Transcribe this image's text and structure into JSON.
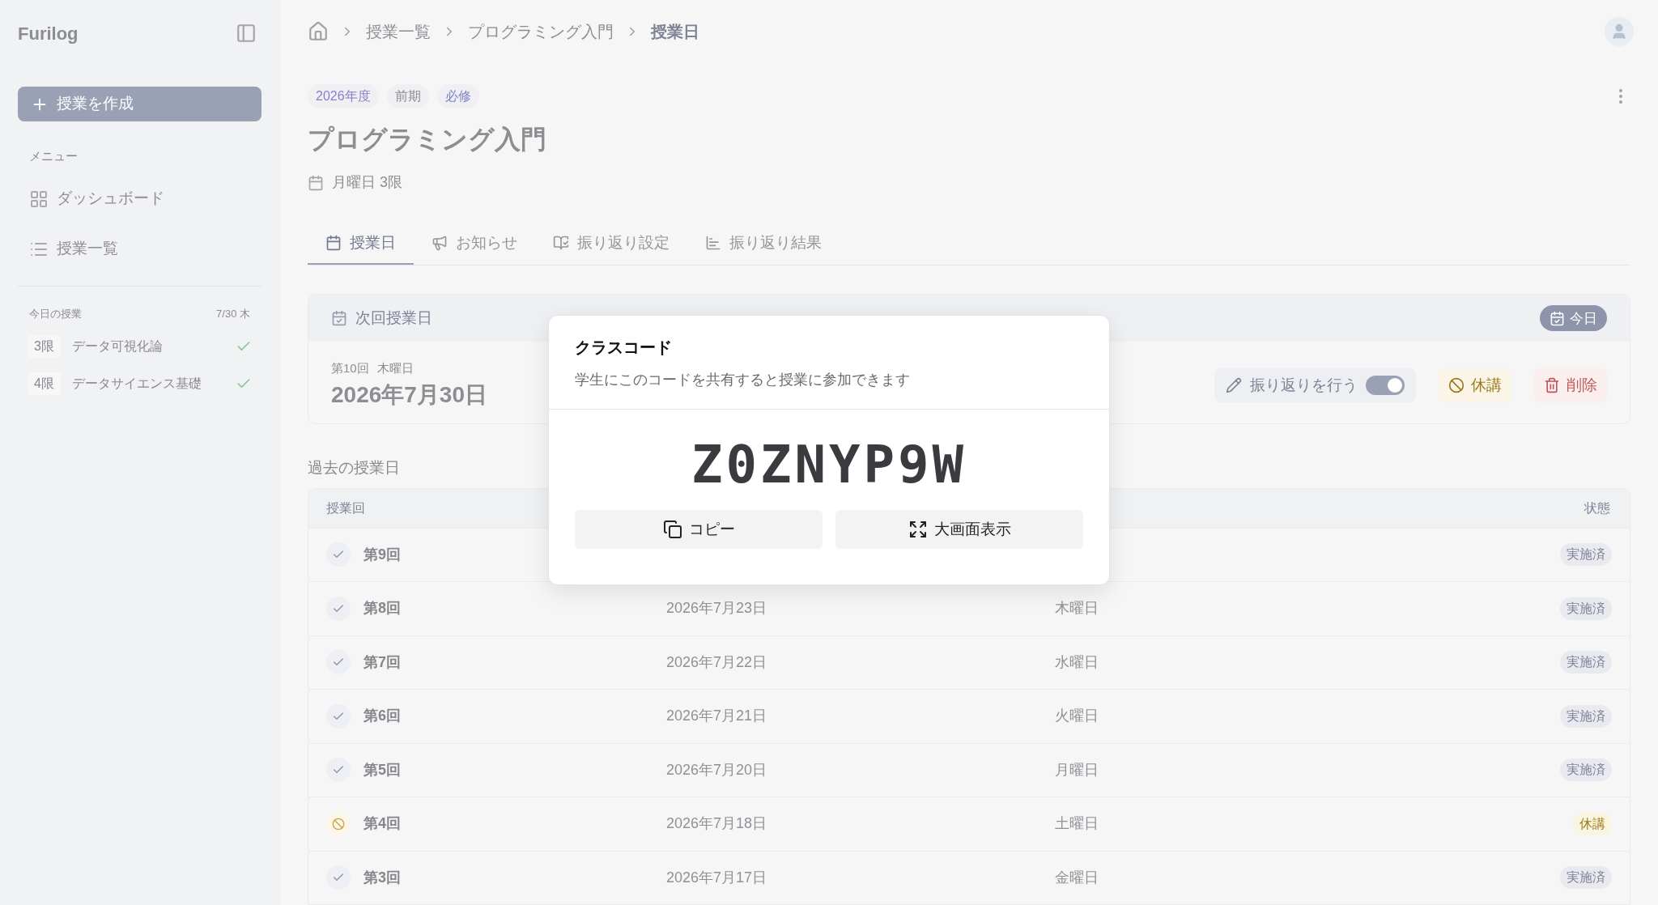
{
  "sidebar": {
    "brand": "Furilog",
    "create_button": "授業を作成",
    "menu_heading": "メニュー",
    "items": [
      {
        "label": "ダッシュボード",
        "kind": "dashboard"
      },
      {
        "label": "授業一覧",
        "kind": "list"
      }
    ],
    "today": {
      "heading": "今日の授業",
      "date": "7/30 木",
      "classes": [
        {
          "period": "3限",
          "name": "データ可視化論",
          "done": true
        },
        {
          "period": "4限",
          "name": "データサイエンス基礎",
          "done": true
        }
      ]
    }
  },
  "breadcrumb": [
    "授業一覧",
    "プログラミング入門",
    "授業日"
  ],
  "tags": [
    {
      "label": "2026年度",
      "color": "#8e7cc6"
    },
    {
      "label": "前期",
      "color": "#8a8a90"
    },
    {
      "label": "必修",
      "color": "#7f85c4"
    }
  ],
  "course": {
    "title": "プログラミング入門",
    "schedule": "月曜日 3限"
  },
  "tabs": [
    {
      "label": "授業日",
      "kind": "calendar",
      "selected": true
    },
    {
      "label": "お知らせ",
      "kind": "megaphone",
      "selected": false
    },
    {
      "label": "振り返り設定",
      "kind": "book",
      "selected": false
    },
    {
      "label": "振り返り結果",
      "kind": "chart",
      "selected": false
    }
  ],
  "next_class": {
    "heading": "次回授業日",
    "today_badge": "今日",
    "number": "第10回",
    "weekday": "木曜日",
    "date": "2026年7月30日",
    "reflection_label": "振り返りを行う",
    "reflection_on": true,
    "cancel_button": "休講",
    "delete_button": "削除"
  },
  "past": {
    "heading": "過去の授業日",
    "columns": [
      {
        "label": "授業回"
      },
      {
        "label": "状態"
      }
    ],
    "rows": [
      {
        "number": "第9回",
        "kind": "done",
        "status": "実施済"
      },
      {
        "number": "第8回",
        "date": "2026年7月23日",
        "weekday": "木曜日",
        "kind": "done",
        "status": "実施済"
      },
      {
        "number": "第7回",
        "date": "2026年7月22日",
        "weekday": "水曜日",
        "kind": "done",
        "status": "実施済"
      },
      {
        "number": "第6回",
        "date": "2026年7月21日",
        "weekday": "火曜日",
        "kind": "done",
        "status": "実施済"
      },
      {
        "number": "第5回",
        "date": "2026年7月20日",
        "weekday": "月曜日",
        "kind": "done",
        "status": "実施済"
      },
      {
        "number": "第4回",
        "date": "2026年7月18日",
        "weekday": "土曜日",
        "kind": "cancelled",
        "status": "休講"
      },
      {
        "number": "第3回",
        "date": "2026年7月17日",
        "weekday": "金曜日",
        "kind": "done",
        "status": "実施済"
      }
    ]
  },
  "modal": {
    "title": "クラスコード",
    "description": "学生にこのコードを共有すると授業に参加できます",
    "code": "Z0ZNYP9W",
    "buttons": [
      {
        "label": "コピー",
        "kind": "copy"
      },
      {
        "label": "大画面表示",
        "kind": "fullscreen"
      }
    ]
  }
}
